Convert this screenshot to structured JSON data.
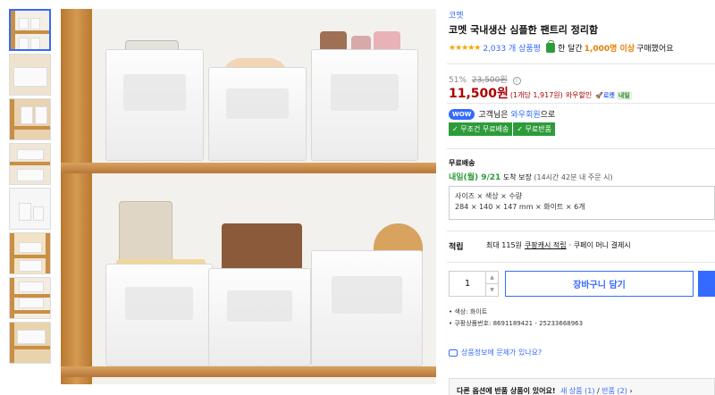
{
  "thumbnails": [
    "thumb-1",
    "thumb-2",
    "thumb-3",
    "thumb-4",
    "thumb-5",
    "thumb-6",
    "thumb-7",
    "thumb-8"
  ],
  "product": {
    "brand": "코멧",
    "title": "코멧 국내생산 심플한 팬트리 정리함",
    "stars": "★★★★★",
    "review_count": "2,033 개 상품평",
    "bought_prefix": "한 달간",
    "bought_count": "1,000명 이상",
    "bought_suffix": "구매했어요",
    "discount_rate": "51%",
    "original_price": "23,500원",
    "price": "11,500원",
    "unit_price": "(1개당 1,917원)",
    "member_discount": "와우할인",
    "rocket_label": "로켓",
    "rocket_day": "내일",
    "wow_badge": "WOW",
    "wow_prefix": "고객님은",
    "wow_link": "와우회원",
    "wow_suffix": "으로",
    "ship_tags": [
      "✓ 무조건 무료배송",
      "✓ 무료반품"
    ],
    "free_shipping": "무료배송",
    "delivery_date": "내일(월) 9/21",
    "delivery_suffix": "도착 보장",
    "delivery_note": "(14시간 42분 내 주문 시)",
    "option_labels": "사이즈 × 색상 × 수량",
    "option_values": "284 × 140 × 147 mm × 화이트 × 6개",
    "cash_label": "적립",
    "cash_prefix": "최대 115원",
    "cash_link": "쿠팡캐시 적립",
    "cash_suffix": "· 쿠페이 머니 결제시",
    "quantity": "1",
    "cart_button": "장바구니 담기",
    "bullets": [
      "색상: 화이트",
      "쿠팡상품번호: 8691189421 - 25233668963"
    ],
    "report_link": "상품정보에 문제가 있나요?",
    "other_title": "다른 옵션에 반품 상품이 있어요!",
    "other_new": "새 상품 (1)",
    "other_sep": " / ",
    "other_return": "반품 (2)",
    "other_chevron": "›"
  }
}
